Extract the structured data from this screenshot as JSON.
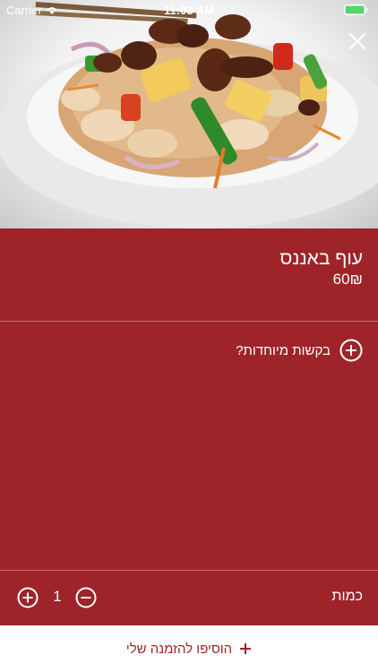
{
  "status_bar": {
    "carrier": "Carrier",
    "time": "11:03 AM",
    "wifi_icon": "wifi-icon",
    "battery_icon": "battery-icon"
  },
  "hero": {
    "image": "stir-fry-dish-photo",
    "close_icon": "close-icon"
  },
  "item": {
    "name": "עוף באננס",
    "price": "60₪"
  },
  "special_requests": {
    "label": "בקשות מיוחדות?",
    "icon": "plus-circle-icon"
  },
  "quantity": {
    "label": "כמות",
    "value": "1",
    "plus_icon": "plus-circle-icon",
    "minus_icon": "minus-circle-icon"
  },
  "add_to_order": {
    "label": "הוסיפו להזמנה שלי",
    "icon": "plus-icon"
  },
  "colors": {
    "panel": "#9e2429",
    "text_on_panel": "#ffffff",
    "accent": "#9e2429",
    "battery": "#4cd964"
  }
}
